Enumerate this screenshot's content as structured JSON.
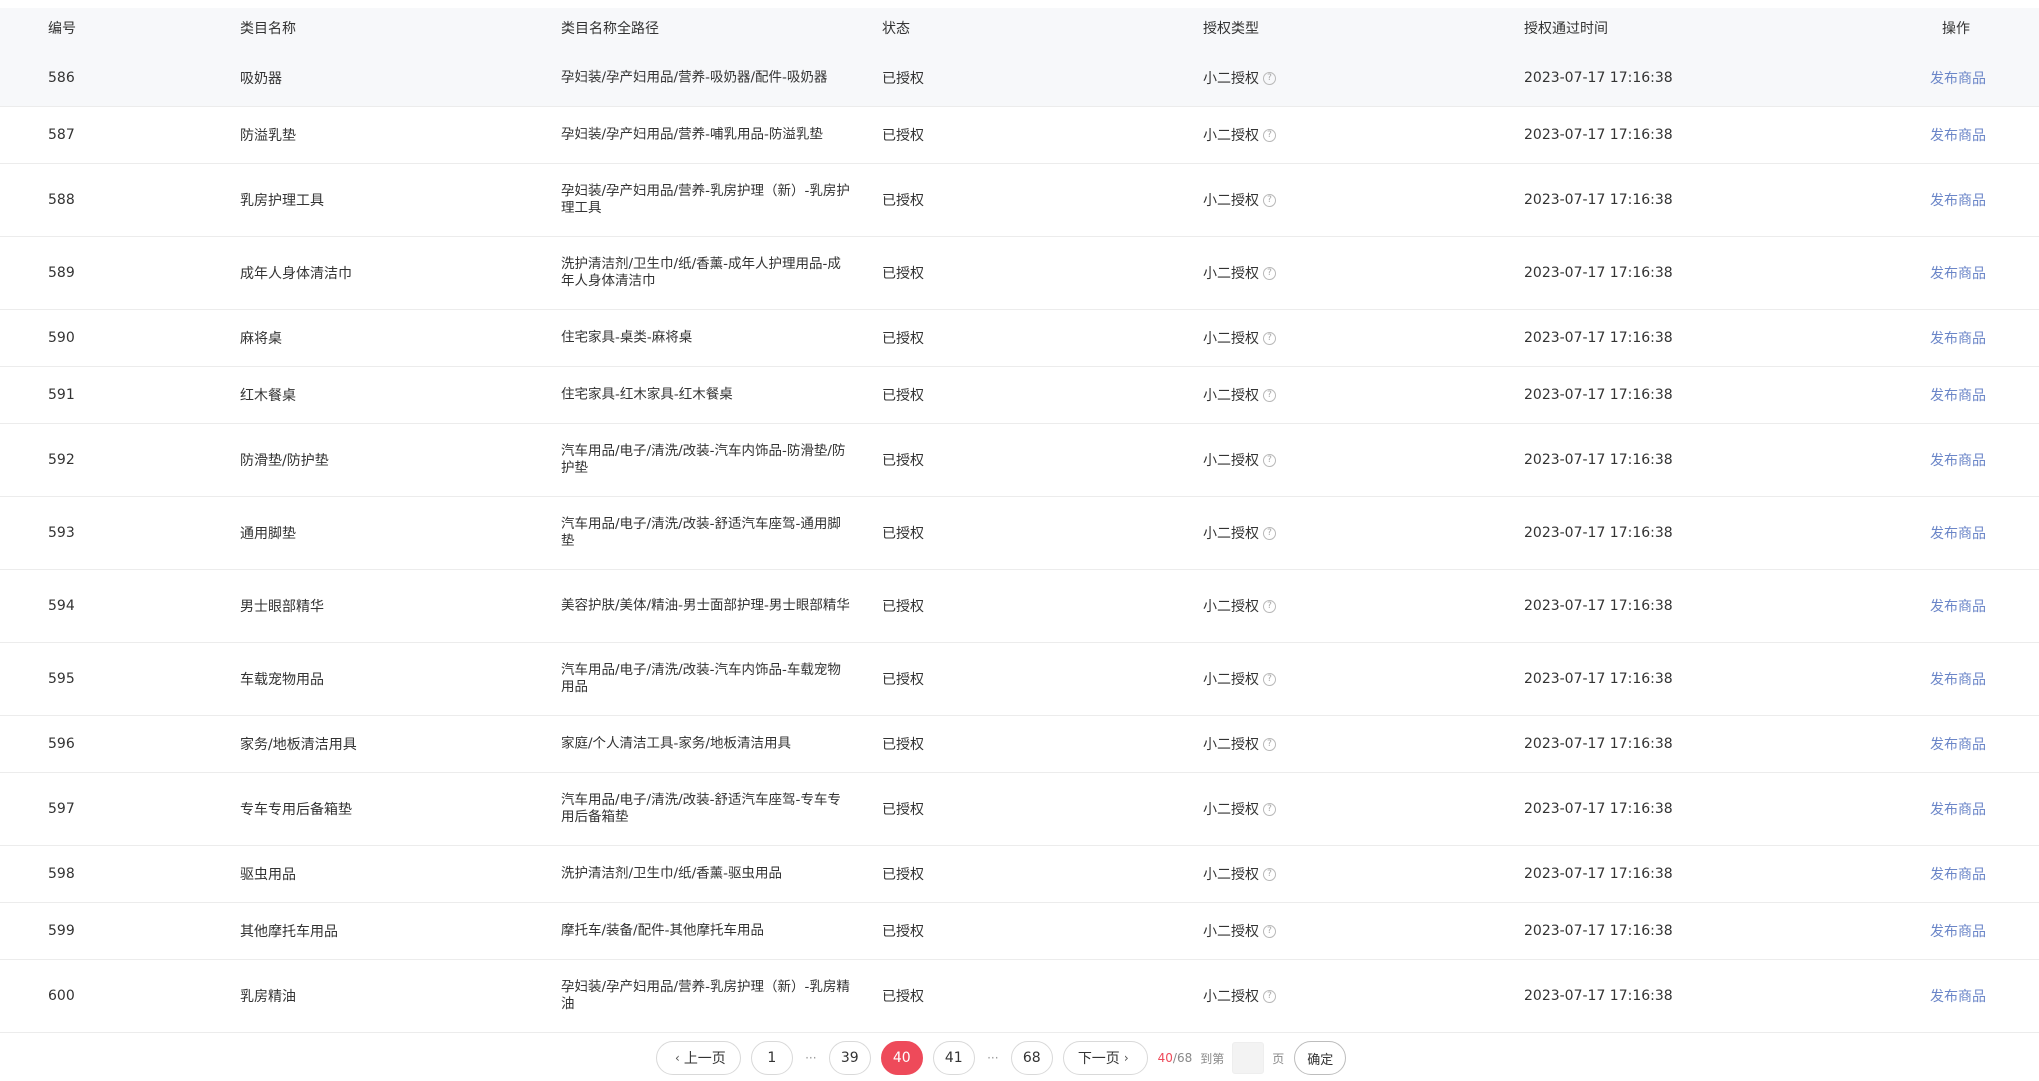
{
  "table": {
    "headers": {
      "id": "编号",
      "name": "类目名称",
      "path": "类目名称全路径",
      "status": "状态",
      "auth_type": "授权类型",
      "auth_time": "授权通过时间",
      "op": "操作"
    },
    "rows": [
      {
        "id": "586",
        "name": "吸奶器",
        "path": "孕妇装/孕产妇用品/营养-吸奶器/配件-吸奶器",
        "status": "已授权",
        "auth_type": "小二授权",
        "auth_time": "2023-07-17 17:16:38",
        "op": "发布商品"
      },
      {
        "id": "587",
        "name": "防溢乳垫",
        "path": "孕妇装/孕产妇用品/营养-哺乳用品-防溢乳垫",
        "status": "已授权",
        "auth_type": "小二授权",
        "auth_time": "2023-07-17 17:16:38",
        "op": "发布商品"
      },
      {
        "id": "588",
        "name": "乳房护理工具",
        "path": "孕妇装/孕产妇用品/营养-乳房护理（新）-乳房护理工具",
        "status": "已授权",
        "auth_type": "小二授权",
        "auth_time": "2023-07-17 17:16:38",
        "op": "发布商品"
      },
      {
        "id": "589",
        "name": "成年人身体清洁巾",
        "path": "洗护清洁剂/卫生巾/纸/香薰-成年人护理用品-成年人身体清洁巾",
        "status": "已授权",
        "auth_type": "小二授权",
        "auth_time": "2023-07-17 17:16:38",
        "op": "发布商品"
      },
      {
        "id": "590",
        "name": "麻将桌",
        "path": "住宅家具-桌类-麻将桌",
        "status": "已授权",
        "auth_type": "小二授权",
        "auth_time": "2023-07-17 17:16:38",
        "op": "发布商品"
      },
      {
        "id": "591",
        "name": "红木餐桌",
        "path": "住宅家具-红木家具-红木餐桌",
        "status": "已授权",
        "auth_type": "小二授权",
        "auth_time": "2023-07-17 17:16:38",
        "op": "发布商品"
      },
      {
        "id": "592",
        "name": "防滑垫/防护垫",
        "path": "汽车用品/电子/清洗/改装-汽车内饰品-防滑垫/防护垫",
        "status": "已授权",
        "auth_type": "小二授权",
        "auth_time": "2023-07-17 17:16:38",
        "op": "发布商品"
      },
      {
        "id": "593",
        "name": "通用脚垫",
        "path": "汽车用品/电子/清洗/改装-舒适汽车座驾-通用脚垫",
        "status": "已授权",
        "auth_type": "小二授权",
        "auth_time": "2023-07-17 17:16:38",
        "op": "发布商品"
      },
      {
        "id": "594",
        "name": "男士眼部精华",
        "path": "美容护肤/美体/精油-男士面部护理-男士眼部精华",
        "status": "已授权",
        "auth_type": "小二授权",
        "auth_time": "2023-07-17 17:16:38",
        "op": "发布商品"
      },
      {
        "id": "595",
        "name": "车载宠物用品",
        "path": "汽车用品/电子/清洗/改装-汽车内饰品-车载宠物用品",
        "status": "已授权",
        "auth_type": "小二授权",
        "auth_time": "2023-07-17 17:16:38",
        "op": "发布商品"
      },
      {
        "id": "596",
        "name": "家务/地板清洁用具",
        "path": "家庭/个人清洁工具-家务/地板清洁用具",
        "status": "已授权",
        "auth_type": "小二授权",
        "auth_time": "2023-07-17 17:16:38",
        "op": "发布商品"
      },
      {
        "id": "597",
        "name": "专车专用后备箱垫",
        "path": "汽车用品/电子/清洗/改装-舒适汽车座驾-专车专用后备箱垫",
        "status": "已授权",
        "auth_type": "小二授权",
        "auth_time": "2023-07-17 17:16:38",
        "op": "发布商品"
      },
      {
        "id": "598",
        "name": "驱虫用品",
        "path": "洗护清洁剂/卫生巾/纸/香薰-驱虫用品",
        "status": "已授权",
        "auth_type": "小二授权",
        "auth_time": "2023-07-17 17:16:38",
        "op": "发布商品"
      },
      {
        "id": "599",
        "name": "其他摩托车用品",
        "path": "摩托车/装备/配件-其他摩托车用品",
        "status": "已授权",
        "auth_type": "小二授权",
        "auth_time": "2023-07-17 17:16:38",
        "op": "发布商品"
      },
      {
        "id": "600",
        "name": "乳房精油",
        "path": "孕妇装/孕产妇用品/营养-乳房护理（新）-乳房精油",
        "status": "已授权",
        "auth_type": "小二授权",
        "auth_time": "2023-07-17 17:16:38",
        "op": "发布商品"
      }
    ]
  },
  "pagination": {
    "prev_label": "上一页",
    "next_label": "下一页",
    "first_page": "1",
    "pages": [
      "39",
      "40",
      "41"
    ],
    "last_page": "68",
    "ellipsis": "···",
    "current_page": "40",
    "current_page_text": "40",
    "total_text": "/68",
    "goto_prefix": "到第",
    "goto_suffix": "页",
    "goto_value": "",
    "confirm_label": "确定"
  },
  "colors": {
    "accent": "#ee4a5a",
    "link": "#6b86c8",
    "header_bg": "#f7f8fa"
  },
  "icons": {
    "help": "question-circle-icon",
    "prev": "chevron-left-icon",
    "next": "chevron-right-icon"
  }
}
